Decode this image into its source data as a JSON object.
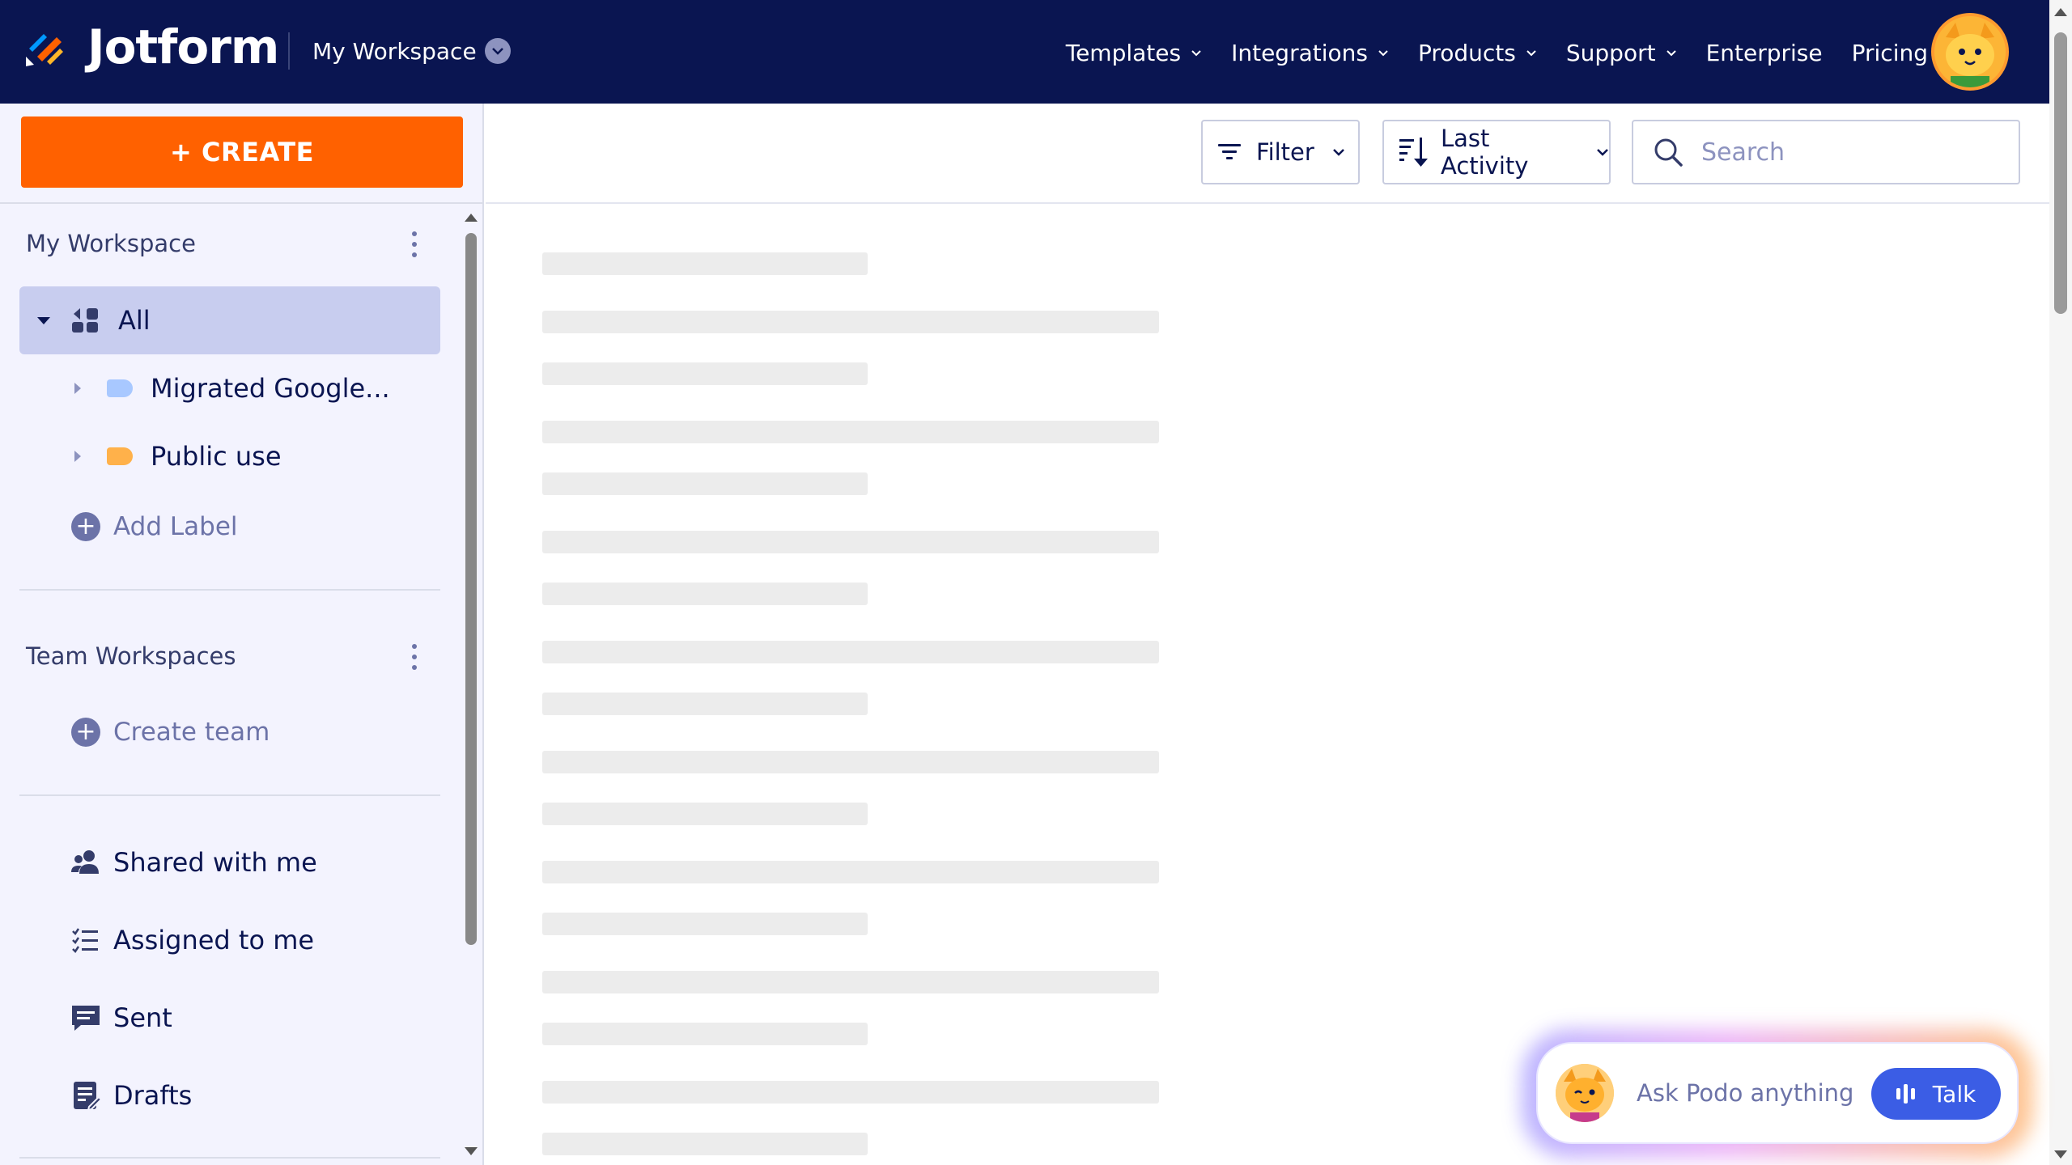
{
  "header": {
    "logo_text": "Jotform",
    "workspace_label": "My Workspace",
    "nav": [
      {
        "label": "Templates",
        "dropdown": true
      },
      {
        "label": "Integrations",
        "dropdown": true
      },
      {
        "label": "Products",
        "dropdown": true
      },
      {
        "label": "Support",
        "dropdown": true
      },
      {
        "label": "Enterprise",
        "dropdown": false
      },
      {
        "label": "Pricing",
        "dropdown": false
      }
    ]
  },
  "sidebar": {
    "create_label": "+ CREATE",
    "my_workspace_title": "My Workspace",
    "folders": {
      "all_label": "All",
      "children": [
        {
          "label": "Migrated Google...",
          "color": "#a8c8ff"
        },
        {
          "label": "Public use",
          "color": "#ffb14a"
        }
      ],
      "add_label": "Add Label"
    },
    "team_title": "Team Workspaces",
    "create_team_label": "Create team",
    "items": [
      {
        "label": "Shared with me",
        "icon": "shared-users-icon"
      },
      {
        "label": "Assigned to me",
        "icon": "checklist-icon"
      },
      {
        "label": "Sent",
        "icon": "message-icon"
      },
      {
        "label": "Drafts",
        "icon": "drafts-icon"
      }
    ]
  },
  "toolbar": {
    "filter_label": "Filter",
    "sort_label": "Last Activity",
    "search_placeholder": "Search"
  },
  "podo": {
    "prompt": "Ask Podo anything",
    "talk_label": "Talk"
  },
  "colors": {
    "nav_bg": "#0a1551",
    "create_orange": "#ff6100",
    "sidebar_bg": "#f3f3fe",
    "selected_bg": "#c8cdef",
    "talk_blue": "#3b5de5"
  }
}
